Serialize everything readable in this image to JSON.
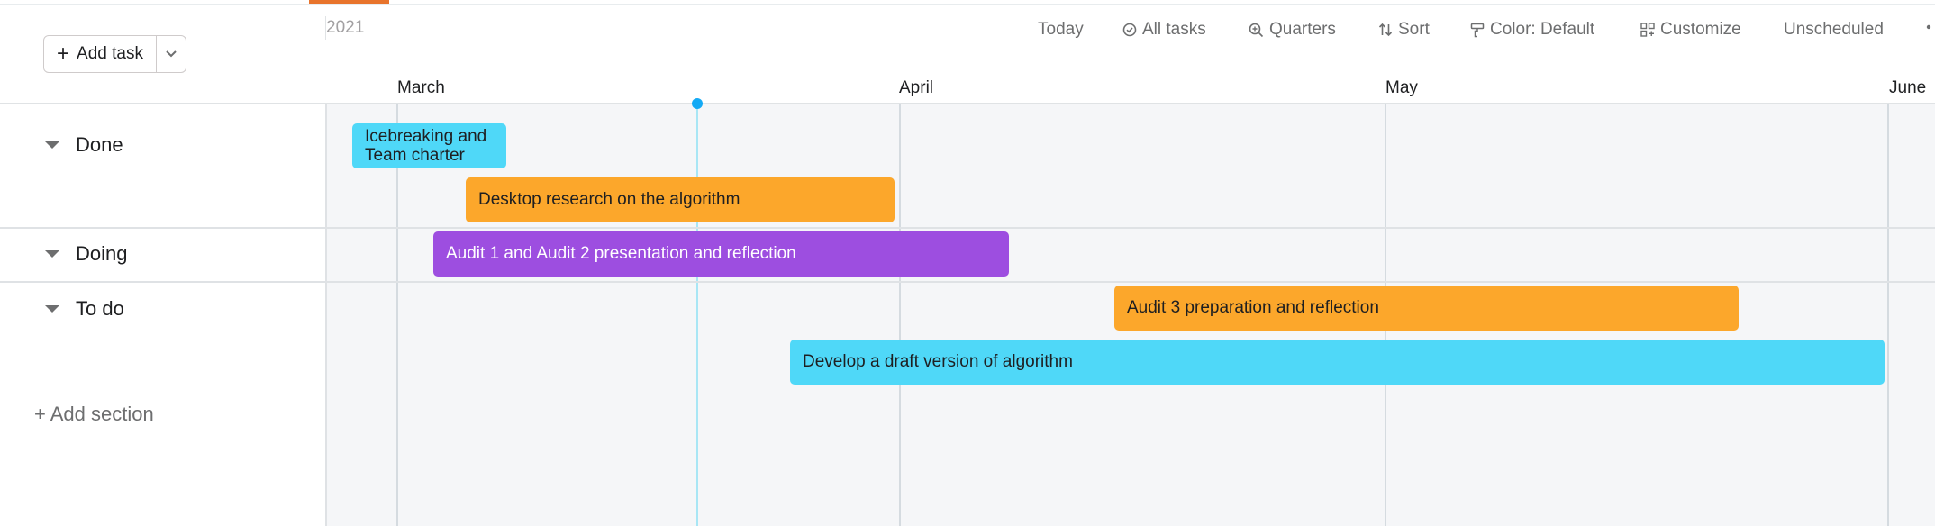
{
  "toolbar": {
    "add_task_label": "Add task",
    "year": "2021",
    "items": [
      {
        "label": "Today",
        "icon": ""
      },
      {
        "label": "All tasks",
        "icon": "check-circle-icon"
      },
      {
        "label": "Quarters",
        "icon": "zoom-icon"
      },
      {
        "label": "Sort",
        "icon": "sort-icon"
      },
      {
        "label": "Color: Default",
        "icon": "paint-roller-icon"
      },
      {
        "label": "Customize",
        "icon": "grid-icon"
      },
      {
        "label": "Unscheduled",
        "icon": ""
      }
    ]
  },
  "months": [
    "March",
    "April",
    "May",
    "June"
  ],
  "sections": [
    {
      "name": "Done"
    },
    {
      "name": "Doing"
    },
    {
      "name": "To do"
    }
  ],
  "add_section_label": "+ Add section",
  "tasks": [
    {
      "name": "Icebreaking and Team charter",
      "color": "#4fd8f8"
    },
    {
      "name": "Desktop research on the algorithm",
      "color": "#fca72b"
    },
    {
      "name": "Audit 1 and Audit 2 presentation and reflection",
      "color": "#9d4ee0"
    },
    {
      "name": "Audit 3 preparation and reflection",
      "color": "#fca72b"
    },
    {
      "name": "Develop a draft version of algorithm",
      "color": "#4fd8f8"
    }
  ],
  "colors": {
    "accent": "#e8742c",
    "today_marker": "#14aaf5",
    "grid_bg": "#f5f6f8"
  }
}
